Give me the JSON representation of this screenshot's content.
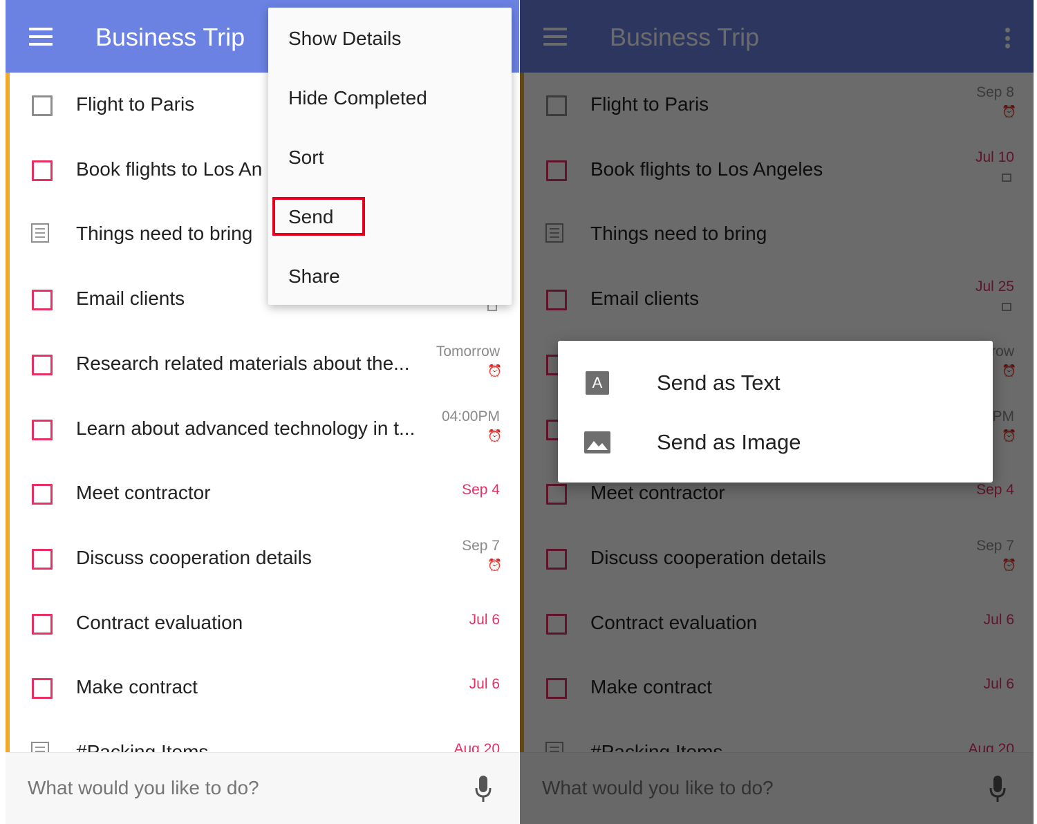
{
  "app": {
    "title": "Business Trip"
  },
  "colors": {
    "left_appbar": "#6b82e3",
    "right_appbar": "#2a366e",
    "accent_bar": "#f3a72c",
    "checkbox_red": "#e53164",
    "highlight": "#e6001e"
  },
  "left_tasks": [
    {
      "text": "Flight to Paris",
      "type": "gray-checkbox",
      "due": "",
      "icon": ""
    },
    {
      "text": "Book flights to Los An",
      "type": "checkbox",
      "due": "",
      "icon": ""
    },
    {
      "text": "Things need to bring",
      "type": "note",
      "due": "",
      "icon": ""
    },
    {
      "text": "Email clients",
      "type": "checkbox",
      "due": "",
      "icon": "note-icon"
    },
    {
      "text": "Research related materials about the...",
      "type": "checkbox",
      "due": "Tomorrow",
      "icon": "alarm-icon"
    },
    {
      "text": "Learn about advanced technology in t...",
      "type": "checkbox",
      "due": "04:00PM",
      "icon": "alarm-icon"
    },
    {
      "text": "Meet contractor",
      "type": "checkbox",
      "due": "Sep 4",
      "due_style": "red",
      "icon": ""
    },
    {
      "text": "Discuss cooperation details",
      "type": "checkbox",
      "due": "Sep 7",
      "icon": "alarm-icon"
    },
    {
      "text": "Contract evaluation",
      "type": "checkbox",
      "due": "Jul 6",
      "due_style": "red",
      "icon": ""
    },
    {
      "text": "Make contract",
      "type": "checkbox",
      "due": "Jul 6",
      "due_style": "red",
      "icon": ""
    },
    {
      "text": "#Packing Items",
      "type": "note",
      "due": "Aug 20",
      "due_style": "red",
      "icon": ""
    }
  ],
  "right_tasks": [
    {
      "text": "Flight to Paris",
      "type": "gray-checkbox",
      "due": "Sep 8",
      "icon": "alarm-icon"
    },
    {
      "text": "Book flights to Los Angeles",
      "type": "checkbox",
      "due": "Jul 10",
      "due_style": "red-high",
      "icon": "note-icon"
    },
    {
      "text": "Things need to bring",
      "type": "note",
      "due": "",
      "icon": ""
    },
    {
      "text": "Email clients",
      "type": "checkbox",
      "due": "Jul 25",
      "due_style": "red-high",
      "icon": "note-icon"
    },
    {
      "text": "Research related materials about the...",
      "type": "checkbox",
      "due": "Tomorrow",
      "icon": "alarm-icon"
    },
    {
      "text": "Learn about advanced technology in t...",
      "type": "checkbox",
      "due": "04:00PM",
      "icon": "alarm-icon"
    },
    {
      "text": "Meet contractor",
      "type": "checkbox",
      "due": "Sep 4",
      "due_style": "red",
      "icon": ""
    },
    {
      "text": "Discuss cooperation details",
      "type": "checkbox",
      "due": "Sep 7",
      "icon": "alarm-icon"
    },
    {
      "text": "Contract evaluation",
      "type": "checkbox",
      "due": "Jul 6",
      "due_style": "red",
      "icon": ""
    },
    {
      "text": "Make contract",
      "type": "checkbox",
      "due": "Jul 6",
      "due_style": "red",
      "icon": ""
    },
    {
      "text": "#Packing Items",
      "type": "note",
      "due": "Aug 20",
      "due_style": "red",
      "icon": ""
    }
  ],
  "overflow_menu": {
    "items": [
      "Show Details",
      "Hide Completed",
      "Sort",
      "Send",
      "Share"
    ],
    "highlighted": "Send"
  },
  "send_dialog": {
    "items": [
      {
        "label": "Send as Text",
        "icon": "text-format-icon",
        "glyph": "A"
      },
      {
        "label": "Send as Image",
        "icon": "image-icon"
      }
    ]
  },
  "input": {
    "placeholder": "What would you like to do?"
  }
}
